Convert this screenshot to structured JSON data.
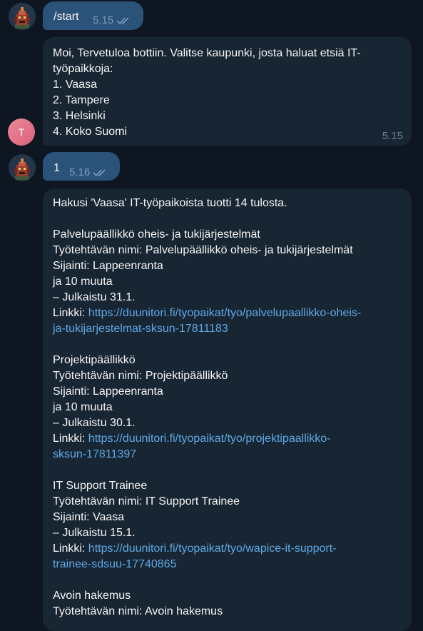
{
  "messages": [
    {
      "sender": "user",
      "text": "/start",
      "time": "5.15"
    },
    {
      "sender": "bot",
      "avatar_letter": "T",
      "lines": [
        "Moi, Tervetuloa bottiin. Valitse kaupunki, josta haluat etsiä IT-",
        "työpaikkoja:",
        "1. Vaasa",
        "2. Tampere",
        "3. Helsinki",
        "4. Koko Suomi"
      ],
      "time": "5.15"
    },
    {
      "sender": "user",
      "text": "1",
      "time": "5.16"
    },
    {
      "sender": "bot",
      "intro": "Hakusi 'Vaasa' IT-työpaikoista tuotti 14 tulosta.",
      "jobs": [
        {
          "title": "Palvelupäällikkö oheis- ja tukijärjestelmät",
          "name_line": "Työtehtävän nimi: Palvelupäällikkö oheis- ja tukijärjestelmät",
          "location_line": "Sijainti: Lappeenranta",
          "extra_line": "ja 10 muuta",
          "published_line": "– Julkaistu 31.1.",
          "link_label": "Linkki: ",
          "link_part1": "https://duunitori.fi/tyopaikat/tyo/palvelupaallikko-oheis-",
          "link_part2": "ja-tukijarjestelmat-sksun-17811183"
        },
        {
          "title": "Projektipäällikkö",
          "name_line": "Työtehtävän nimi: Projektipäällikkö",
          "location_line": "Sijainti: Lappeenranta",
          "extra_line": "ja 10 muuta",
          "published_line": "– Julkaistu 30.1.",
          "link_label": "Linkki: ",
          "link_part1": "https://duunitori.fi/tyopaikat/tyo/projektipaallikko-",
          "link_part2": "sksun-17811397"
        },
        {
          "title": "IT Support Trainee",
          "name_line": "Työtehtävän nimi: IT Support Trainee",
          "location_line": "Sijainti: Vaasa",
          "published_line": "– Julkaistu 15.1.",
          "link_label": "Linkki: ",
          "link_part1": "https://duunitori.fi/tyopaikat/tyo/wapice-it-support-",
          "link_part2": "trainee-sdsuu-17740865"
        },
        {
          "title": "Avoin hakemus",
          "name_line": "Työtehtävän nimi: Avoin hakemus"
        }
      ]
    }
  ],
  "icons": {
    "user_avatar": "pixel-character-avatar-icon",
    "read_receipt": "double-check-icon"
  },
  "colors": {
    "background": "#0e1621",
    "outgoing_bubble": "#2b5278",
    "incoming_bubble": "#182533",
    "link": "#5fa9e6",
    "bot_avatar": "#e07a8e"
  }
}
